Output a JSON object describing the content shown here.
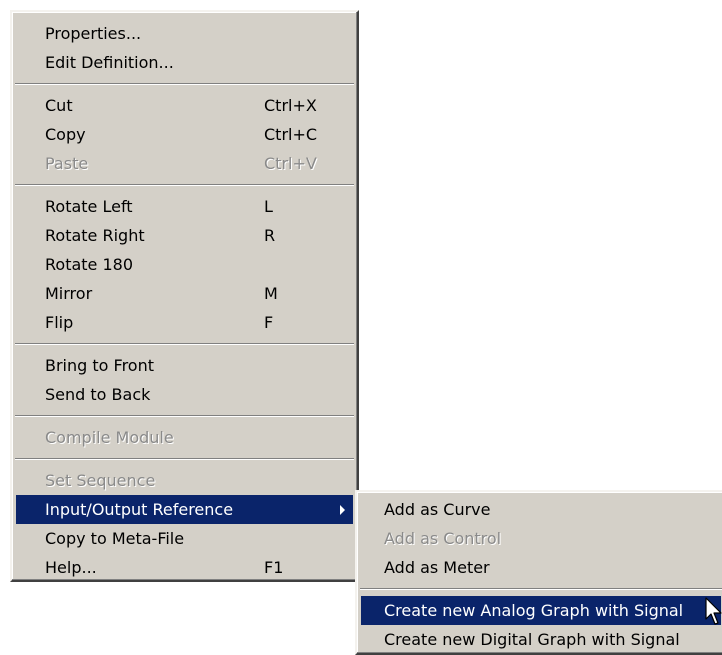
{
  "main_menu": {
    "items": [
      {
        "label": "Properties...",
        "shortcut": ""
      },
      {
        "label": "Edit Definition...",
        "shortcut": ""
      },
      {
        "label": "Cut",
        "shortcut": "Ctrl+X"
      },
      {
        "label": "Copy",
        "shortcut": "Ctrl+C"
      },
      {
        "label": "Paste",
        "shortcut": "Ctrl+V"
      },
      {
        "label": "Rotate Left",
        "shortcut": "L"
      },
      {
        "label": "Rotate Right",
        "shortcut": "R"
      },
      {
        "label": "Rotate 180",
        "shortcut": ""
      },
      {
        "label": "Mirror",
        "shortcut": "M"
      },
      {
        "label": "Flip",
        "shortcut": "F"
      },
      {
        "label": "Bring to Front",
        "shortcut": ""
      },
      {
        "label": "Send to Back",
        "shortcut": ""
      },
      {
        "label": "Compile Module",
        "shortcut": ""
      },
      {
        "label": "Set Sequence",
        "shortcut": ""
      },
      {
        "label": "Input/Output Reference",
        "shortcut": ""
      },
      {
        "label": "Copy to Meta-File",
        "shortcut": ""
      },
      {
        "label": "Help...",
        "shortcut": "F1"
      }
    ]
  },
  "sub_menu": {
    "items": [
      {
        "label": "Add as Curve"
      },
      {
        "label": "Add as Control"
      },
      {
        "label": "Add as Meter"
      },
      {
        "label": "Create new Analog Graph with Signal"
      },
      {
        "label": "Create new Digital Graph with Signal"
      }
    ]
  },
  "colors": {
    "menu_bg": "#d4d0c8",
    "highlight": "#0a246a",
    "disabled_text": "#8a8a8a"
  },
  "icons": {
    "submenu_arrow": "triangle-right",
    "cursor": "arrow-pointer"
  }
}
